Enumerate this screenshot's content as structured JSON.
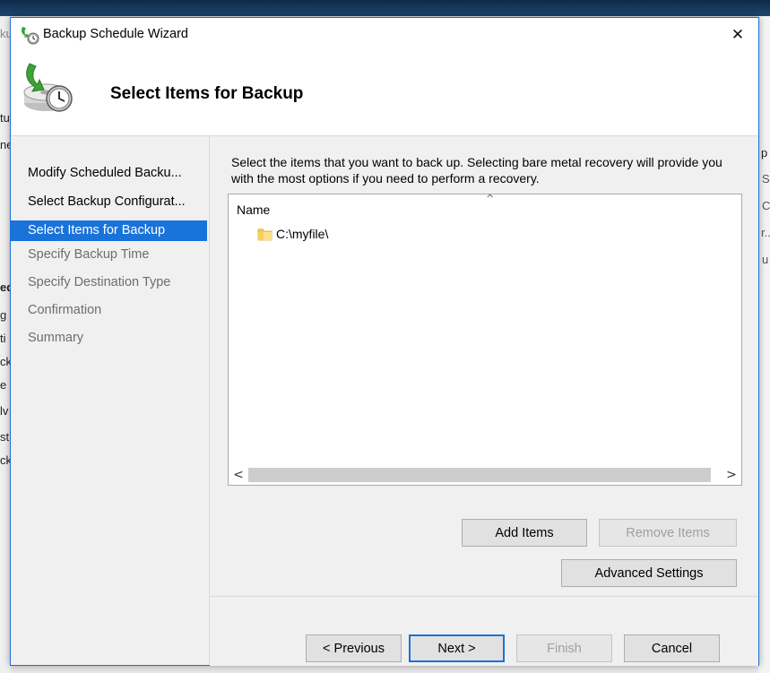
{
  "background_window": {
    "fragments": [
      "kup",
      "tu",
      "ne",
      "p",
      "S",
      "C",
      "r..",
      "u",
      "ed",
      "g",
      "ti",
      "ck",
      "e",
      "lv",
      "st",
      "ck"
    ]
  },
  "window": {
    "title": "Backup Schedule Wizard",
    "close_glyph": "✕"
  },
  "header": {
    "title": "Select Items for Backup"
  },
  "nav": {
    "items": [
      {
        "label": "Modify Scheduled Backu...",
        "state": "done"
      },
      {
        "label": "Select Backup Configurat...",
        "state": "done"
      },
      {
        "label": "Select Items for Backup",
        "state": "current"
      },
      {
        "label": "Specify Backup Time",
        "state": "pending"
      },
      {
        "label": "Specify Destination Type",
        "state": "pending"
      },
      {
        "label": "Confirmation",
        "state": "pending"
      },
      {
        "label": "Summary",
        "state": "pending"
      }
    ]
  },
  "content": {
    "instructions": "Select the items that you want to back up. Selecting bare metal recovery will provide you with the most options if you need to perform a recovery.",
    "list": {
      "column_header": "Name",
      "sort_glyph": "^",
      "items": [
        {
          "label": "C:\\myfile\\",
          "icon": "folder-icon"
        }
      ],
      "scroll_left_glyph": "<",
      "scroll_right_glyph": ">"
    },
    "add_items_label": "Add Items",
    "remove_items_label": "Remove Items",
    "advanced_settings_label": "Advanced Settings"
  },
  "footer": {
    "previous_label": "< Previous",
    "next_label": "Next >",
    "finish_label": "Finish",
    "cancel_label": "Cancel"
  },
  "colors": {
    "accent": "#1a73d9",
    "window_border": "#1e6fd6"
  }
}
